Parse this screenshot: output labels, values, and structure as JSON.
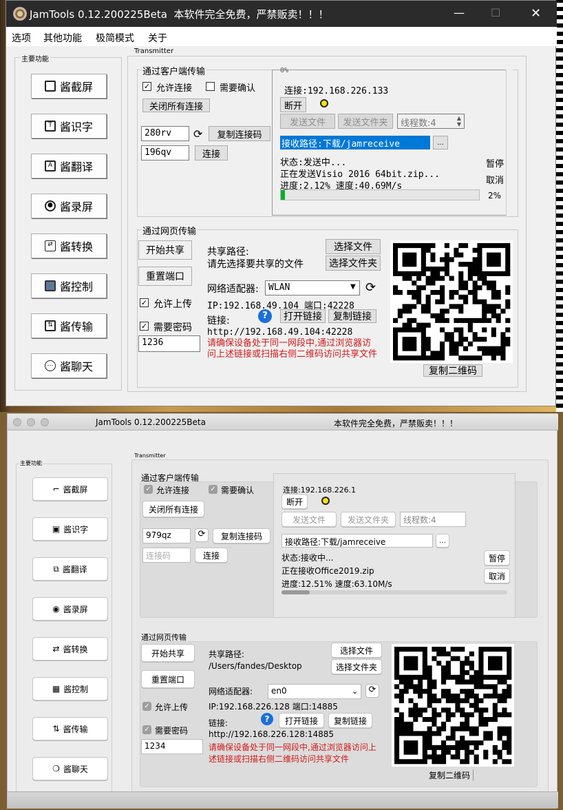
{
  "win": {
    "title": "JamTools 0.12.200225Beta",
    "notice": "本软件完全免费，严禁贩卖！！！",
    "controls": {
      "minimize": "—",
      "maximize": "☐",
      "close": "✕"
    },
    "menu": [
      "选项",
      "其他功能",
      "极简模式",
      "关于"
    ],
    "sidebar_title": "主要功能",
    "functions": [
      "酱截屏",
      "酱识字",
      "酱翻译",
      "酱录屏",
      "酱转换",
      "酱控制",
      "酱传输",
      "酱聊天"
    ],
    "transmitter_title": "Transmitter",
    "client": {
      "title": "通过客户端传输",
      "allow_connect": "允许连接",
      "need_confirm": "需要确认",
      "close_all": "关闭所有连接",
      "code1": "280rv",
      "copy_code": "复制连接码",
      "code2": "196qv",
      "connect": "连接",
      "scroll_top": "0%",
      "conn_addr": "连接:192.168.226.133",
      "disconnect": "断开",
      "send_file": "发送文件",
      "send_folder": "发送文件夹",
      "threads": "线程数:4",
      "recv_path": "接收路径:下载/jamreceive",
      "browse": "...",
      "status": "状态:发送中...",
      "sending": "正在发送Visio 2016 64bit.zip...",
      "progress_text": "进度:2.12% 速度:40.69M/s",
      "pause": "暂停",
      "cancel": "取消",
      "percent": "2%",
      "progress": 0.0212
    },
    "web": {
      "title": "通过网页传输",
      "start_share": "开始共享",
      "share_path_label": "共享路径:",
      "share_path": "请先选择要共享的文件",
      "choose_file": "选择文件",
      "choose_folder": "选择文件夹",
      "reset_port": "重置端口",
      "adapter_label": "网络适配器:",
      "adapter": "WLAN",
      "allow_upload": "允许上传",
      "ip_port": "IP:192.168.49.104  端口:42228",
      "need_password": "需要密码",
      "link_label": "链接:",
      "open_link": "打开链接",
      "copy_link": "复制链接",
      "url": "http://192.168.49.104:42228",
      "password": "1236",
      "warning": "请确保设备处于同一网段中,通过浏览器访问上述链接或扫描右侧二维码访问共享文件",
      "copy_qr": "复制二维码"
    }
  },
  "mac": {
    "title": "JamTools 0.12.200225Beta",
    "notice": "本软件完全免费，严禁贩卖！！！",
    "sidebar_title": "主要功能",
    "functions": [
      "酱截屏",
      "酱识字",
      "酱翻译",
      "酱录屏",
      "酱转换",
      "酱控制",
      "酱传输",
      "酱聊天"
    ],
    "transmitter_title": "Transmitter",
    "client": {
      "title": "通过客户端传输",
      "allow_connect": "允许连接",
      "need_confirm": "需要确认",
      "close_all": "关闭所有连接",
      "code1": "979qz",
      "copy_code": "复制连接码",
      "code_placeholder": "连接码",
      "connect": "连接",
      "conn_addr": "连接:192.168.226.1",
      "disconnect": "断开",
      "send_file": "发送文件",
      "send_folder": "发送文件夹",
      "threads": "线程数:4",
      "recv_path": "接收路径:下载/jamreceive",
      "browse": "...",
      "status": "状态:接收中...",
      "receiving": "正在接收Office2019.zip",
      "progress_text": "进度:12.51% 速度:63.10M/s",
      "pause": "暂停",
      "cancel": "取消",
      "progress": 0.1251
    },
    "web": {
      "title": "通过网页传输",
      "start_share": "开始共享",
      "share_path_label": "共享路径:",
      "share_path": "/Users/fandes/Desktop",
      "choose_file": "选择文件",
      "choose_folder": "选择文件夹",
      "reset_port": "重置端口",
      "adapter_label": "网络适配器:",
      "adapter": "en0",
      "allow_upload": "允许上传",
      "ip_port": "IP:192.168.226.128  端口:14885",
      "need_password": "需要密码",
      "link_label": "链接:",
      "open_link": "打开链接",
      "copy_link": "复制链接",
      "url": "http://192.168.226.128:14885",
      "password": "1234",
      "warning": "请确保设备处于同一网段中,通过浏览器访问上述链接或扫描右侧二维码访问共享文件",
      "copy_qr": "复制二维码"
    }
  },
  "colors": {
    "warning": "#d21a1a",
    "selection": "#0078d7",
    "progress": "#06b025",
    "status_dot": "#f5e50a"
  }
}
